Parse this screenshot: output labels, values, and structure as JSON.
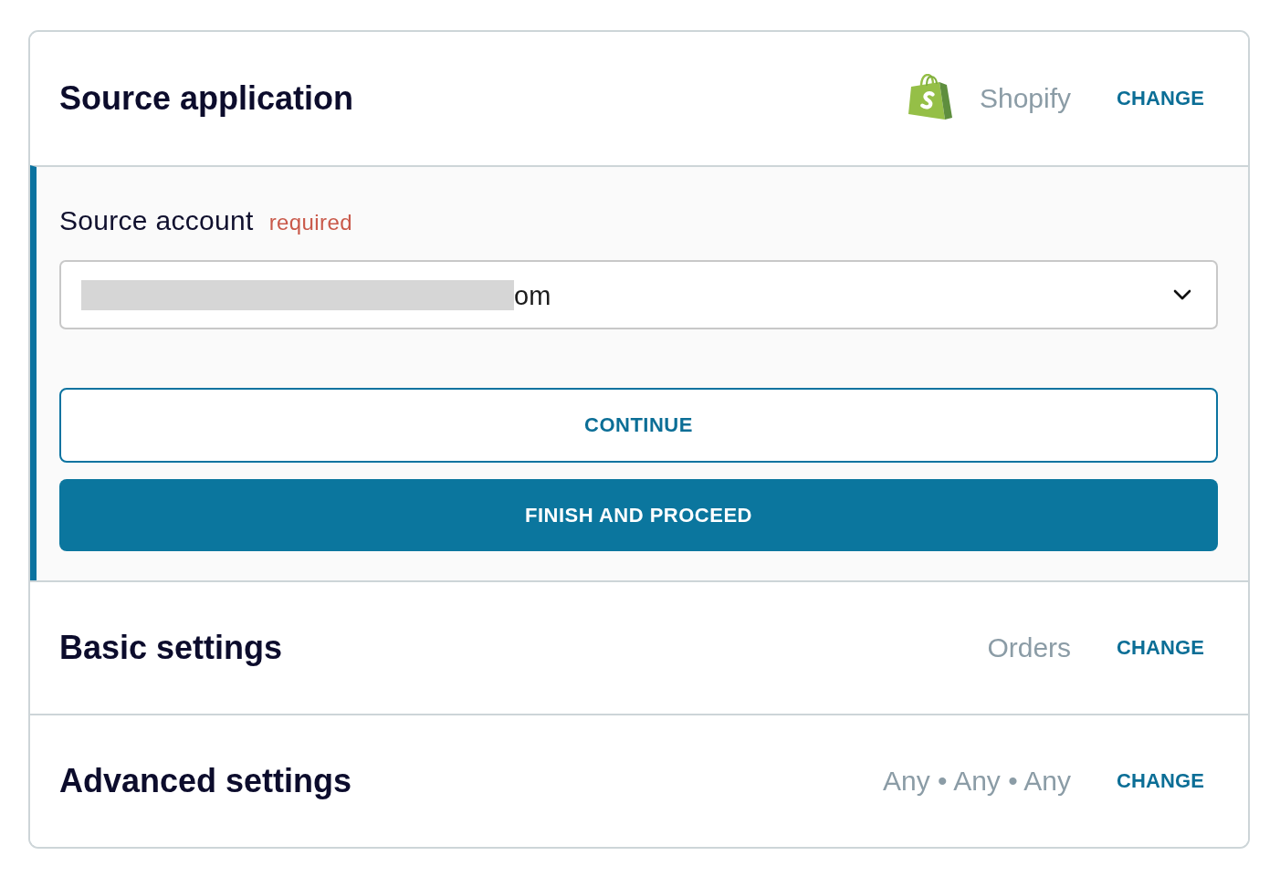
{
  "sections": [
    {
      "kind": "app",
      "active": false,
      "title": "Source application",
      "summary": "Shopify",
      "action": "CHANGE"
    },
    {
      "kind": "form",
      "active": true,
      "label": "Source account",
      "required_label": "required",
      "select": {
        "value": "om",
        "redacted": true
      },
      "buttons": [
        {
          "label": "CONTINUE",
          "kind": "outline"
        },
        {
          "label": "FINISH AND PROCEED",
          "kind": "primary"
        }
      ]
    },
    {
      "kind": "summary",
      "active": false,
      "title": "Basic settings",
      "summary": "Orders",
      "action": "CHANGE"
    },
    {
      "kind": "summary",
      "active": false,
      "title": "Advanced settings",
      "summary": "Any • Any • Any",
      "action": "CHANGE"
    }
  ]
}
